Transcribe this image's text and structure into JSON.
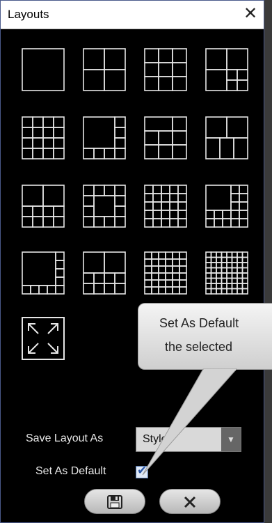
{
  "dialog": {
    "title": "Layouts",
    "close_glyph": "✕"
  },
  "layouts": [
    {
      "name": "layout-1x1"
    },
    {
      "name": "layout-2x2"
    },
    {
      "name": "layout-3x3"
    },
    {
      "name": "layout-big-plus-small"
    },
    {
      "name": "layout-4x4"
    },
    {
      "name": "layout-big-plus-right-bottom"
    },
    {
      "name": "layout-big-right-column"
    },
    {
      "name": "layout-3-plus-2"
    },
    {
      "name": "layout-2-top-4-bottom"
    },
    {
      "name": "layout-center-ring"
    },
    {
      "name": "layout-5x5"
    },
    {
      "name": "layout-big-corner-grid"
    },
    {
      "name": "layout-big-plus-edge"
    },
    {
      "name": "layout-left-right-split"
    },
    {
      "name": "layout-6x6"
    },
    {
      "name": "layout-8x8"
    }
  ],
  "fullscreen_icon": "fullscreen-expand-icon",
  "save_layout": {
    "label": "Save Layout As",
    "value": "Style",
    "arrow": "▼"
  },
  "set_default": {
    "label": "Set As Default",
    "checked_glyph": "✔"
  },
  "tooltip": {
    "line1": "Set As Default",
    "line2": "the selected"
  },
  "buttons": {
    "save_icon": "floppy-disk-icon",
    "cancel_icon": "close-icon"
  },
  "colors": {
    "background": "#000000",
    "window_border": "#4a5a8a",
    "grid_line": "#e6e6e6",
    "accent_check": "#2b57a6"
  }
}
